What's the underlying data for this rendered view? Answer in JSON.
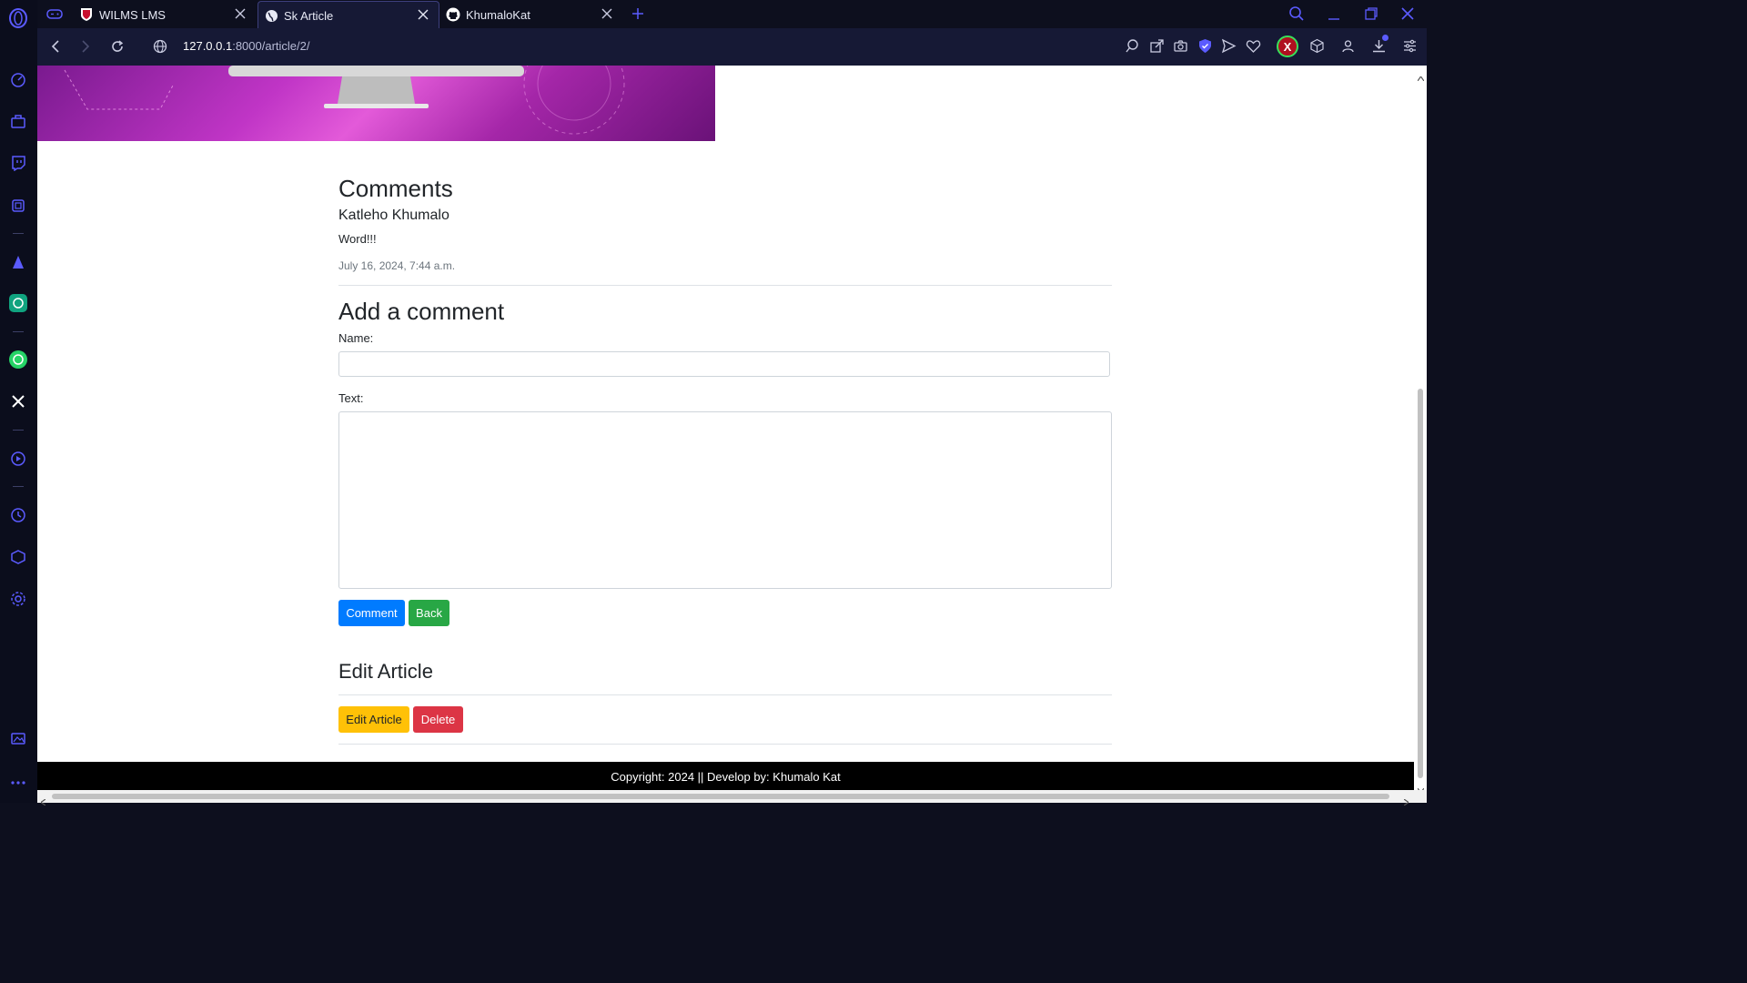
{
  "browser": {
    "tabs": [
      {
        "title": "WILMS LMS",
        "favicon": "university-crest-icon"
      },
      {
        "title": "Sk Article",
        "favicon": "globe-icon"
      },
      {
        "title": "KhumaloKat",
        "favicon": "github-icon"
      }
    ],
    "url_host": "127.0.0.1",
    "url_path": ":8000/article/2/",
    "profile_badge": "X"
  },
  "comments": {
    "heading": "Comments",
    "items": [
      {
        "author": "Katleho Khumalo",
        "text": "Word!!!",
        "date": "July 16, 2024, 7:44 a.m."
      }
    ]
  },
  "add_comment": {
    "heading": "Add a comment",
    "name_label": "Name:",
    "name_value": "",
    "text_label": "Text:",
    "text_value": "",
    "comment_button": "Comment",
    "back_button": "Back"
  },
  "edit_article": {
    "heading": "Edit Article",
    "edit_button": "Edit Article",
    "delete_button": "Delete"
  },
  "footer": {
    "text": "Copyright: 2024 || Develop by: Khumalo Kat"
  },
  "colors": {
    "primary": "#007bff",
    "success": "#28a745",
    "warning": "#ffc107",
    "danger": "#dc3545",
    "accent": "#5b5bff"
  }
}
